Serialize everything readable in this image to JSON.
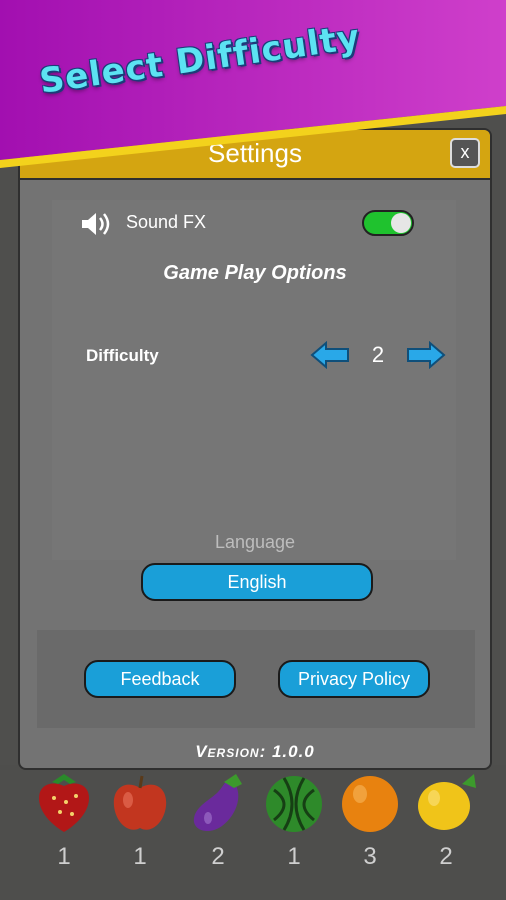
{
  "banner": {
    "title": "Select Difficulty"
  },
  "settings": {
    "title": "Settings",
    "close_label": "x",
    "sound_fx": {
      "label": "Sound FX",
      "enabled": true
    },
    "section_title": "Game Play Options",
    "difficulty": {
      "label": "Difficulty",
      "value": "2"
    },
    "language": {
      "label": "Language",
      "value": "English"
    },
    "feedback_label": "Feedback",
    "privacy_label": "Privacy Policy",
    "version": "Version: 1.0.0"
  },
  "fruits": [
    {
      "name": "strawberry",
      "count": "1"
    },
    {
      "name": "apple",
      "count": "1"
    },
    {
      "name": "eggplant",
      "count": "2"
    },
    {
      "name": "watermelon",
      "count": "1"
    },
    {
      "name": "orange",
      "count": "3"
    },
    {
      "name": "lemon",
      "count": "2"
    }
  ],
  "colors": {
    "banner": "#b01ab8",
    "header": "#d4a511",
    "button": "#1a9fd8",
    "toggle_on": "#1fc22e",
    "arrow": "#29a8e8"
  }
}
